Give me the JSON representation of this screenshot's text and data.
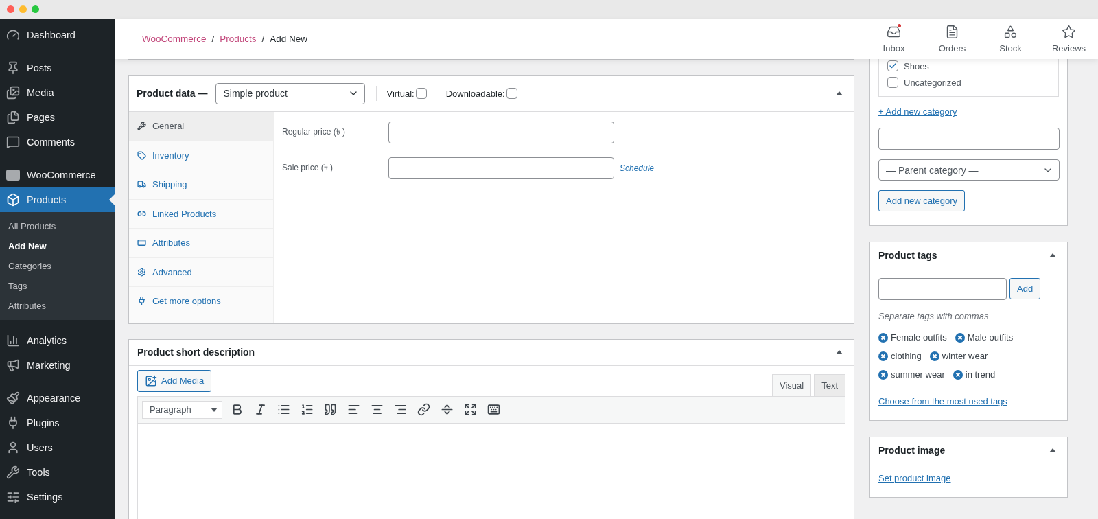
{
  "window": {
    "controls": [
      {
        "color": "#ff5f57"
      },
      {
        "color": "#febc2e"
      },
      {
        "color": "#28c840"
      }
    ]
  },
  "sidebar": {
    "sections": [
      {
        "items": [
          {
            "label": "Dashboard",
            "selected": false
          }
        ]
      },
      {
        "items": [
          {
            "label": "Posts",
            "selected": false
          },
          {
            "label": "Media",
            "selected": false
          },
          {
            "label": "Pages",
            "selected": false
          },
          {
            "label": "Comments",
            "selected": false
          }
        ]
      },
      {
        "items": [
          {
            "label": "WooCommerce",
            "selected": false
          },
          {
            "label": "Products",
            "selected": true,
            "children": [
              {
                "label": "All Products",
                "selected": false
              },
              {
                "label": "Add New",
                "selected": true
              },
              {
                "label": "Categories",
                "selected": false
              },
              {
                "label": "Tags",
                "selected": false
              },
              {
                "label": "Attributes",
                "selected": false
              }
            ]
          }
        ]
      },
      {
        "items": [
          {
            "label": "Analytics",
            "selected": false
          },
          {
            "label": "Marketing",
            "selected": false
          }
        ]
      },
      {
        "items": [
          {
            "label": "Appearance",
            "selected": false
          },
          {
            "label": "Plugins",
            "selected": false
          },
          {
            "label": "Users",
            "selected": false
          },
          {
            "label": "Tools",
            "selected": false
          },
          {
            "label": "Settings",
            "selected": false
          }
        ]
      }
    ]
  },
  "breadcrumb": [
    {
      "label": "WooCommerce",
      "kind": "link"
    },
    {
      "label": "/",
      "kind": "separator"
    },
    {
      "label": "Products",
      "kind": "link"
    },
    {
      "label": "/",
      "kind": "separator"
    },
    {
      "label": "Add New",
      "kind": "current"
    }
  ],
  "header_actions": [
    {
      "label": "Inbox",
      "unread": true
    },
    {
      "label": "Orders",
      "unread": false
    },
    {
      "label": "Stock",
      "unread": false
    },
    {
      "label": "Reviews",
      "unread": false
    }
  ],
  "product_data": {
    "title": "Product data —",
    "type": "Simple product",
    "options": [
      {
        "label": "Virtual:",
        "checked": false
      },
      {
        "label": "Downloadable:",
        "checked": false
      }
    ],
    "tabs": [
      {
        "label": "General",
        "selected": true
      },
      {
        "label": "Inventory",
        "selected": false
      },
      {
        "label": "Shipping",
        "selected": false
      },
      {
        "label": "Linked Products",
        "selected": false
      },
      {
        "label": "Attributes",
        "selected": false
      },
      {
        "label": "Advanced",
        "selected": false
      },
      {
        "label": "Get more options",
        "selected": false
      }
    ],
    "fields": [
      {
        "label": "Regular price (৳ )"
      },
      {
        "label": "Sale price (৳ )",
        "link": "Schedule"
      }
    ]
  },
  "short_description": {
    "title": "Product short description",
    "add_media": "Add Media",
    "format": "Paragraph",
    "editor_tabs": [
      {
        "label": "Visual",
        "selected": true
      },
      {
        "label": "Text",
        "selected": false
      }
    ]
  },
  "categories": {
    "items": [
      {
        "label": "Shoes",
        "checked": true
      },
      {
        "label": "Uncategorized",
        "checked": false
      }
    ],
    "add_link": "+ Add new category",
    "parent_select": "— Parent category —",
    "add_button": "Add new category"
  },
  "tags": {
    "title": "Product tags",
    "add_button": "Add",
    "hint": "Separate tags with commas",
    "items": [
      [
        "Female outfits",
        "Male outfits"
      ],
      [
        "clothing",
        "winter wear"
      ],
      [
        "summer wear",
        "in trend"
      ]
    ],
    "link": "Choose from the most used tags"
  },
  "image": {
    "title": "Product image",
    "link": "Set product image"
  }
}
